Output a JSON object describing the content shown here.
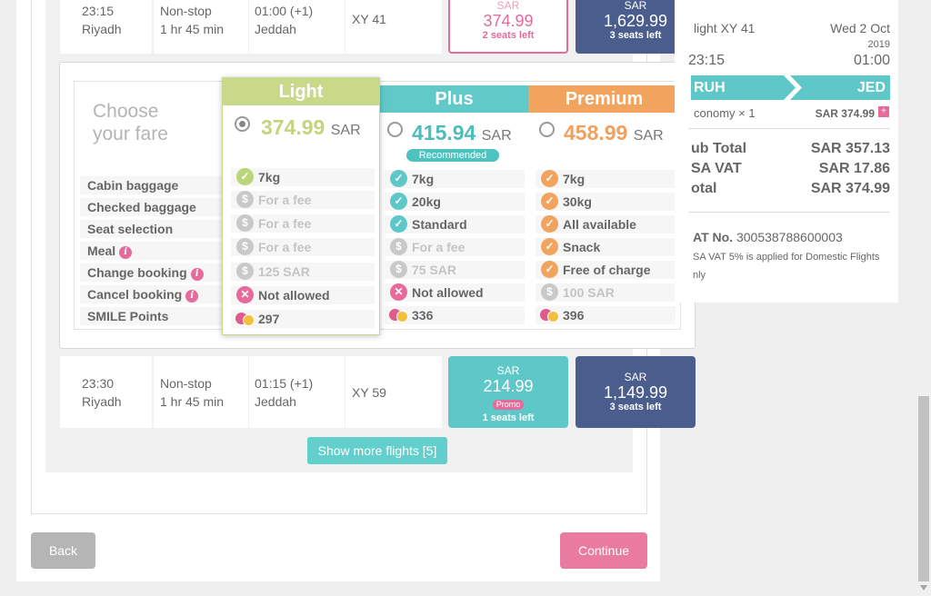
{
  "flights": [
    {
      "dep_time": "23:15",
      "dep_city": "Riyadh",
      "stops": "Non-stop",
      "duration": "1 hr 45 min",
      "arr_time": "01:00 (+1)",
      "arr_city": "Jeddah",
      "flight_no": "XY 41",
      "fare_a": {
        "currency": "SAR",
        "amount": "374.99",
        "seats": "2 seats left"
      },
      "fare_b": {
        "currency": "SAR",
        "amount": "1,629.99",
        "seats": "3 seats left"
      }
    },
    {
      "dep_time": "23:30",
      "dep_city": "Riyadh",
      "stops": "Non-stop",
      "duration": "1 hr 45 min",
      "arr_time": "01:15 (+1)",
      "arr_city": "Jeddah",
      "flight_no": "XY 59",
      "fare_a": {
        "currency": "SAR",
        "amount": "214.99",
        "promo": "Promo",
        "seats": "1 seats left"
      },
      "fare_b": {
        "currency": "SAR",
        "amount": "1,149.99",
        "seats": "3 seats left"
      }
    }
  ],
  "fare_panel": {
    "choose_line1": "Choose",
    "choose_line2": "your fare",
    "rows": [
      "Cabin baggage",
      "Checked baggage",
      "Seat selection",
      "Meal",
      "Change booking",
      "Cancel booking",
      "SMILE Points"
    ],
    "light": {
      "name": "Light",
      "price": "374.99",
      "currency": "SAR",
      "features": [
        "7kg",
        "For a fee",
        "For a fee",
        "For a fee",
        "125 SAR",
        "Not allowed",
        "297"
      ]
    },
    "plus": {
      "name": "Plus",
      "price": "415.94",
      "currency": "SAR",
      "badge": "Recommended",
      "features": [
        "7kg",
        "20kg",
        "Standard",
        "For a fee",
        "75 SAR",
        "Not allowed",
        "336"
      ]
    },
    "premium": {
      "name": "Premium",
      "price": "458.99",
      "currency": "SAR",
      "features": [
        "7kg",
        "30kg",
        "All available",
        "Snack",
        "Free of charge",
        "100 SAR",
        "396"
      ]
    }
  },
  "buttons": {
    "show_more": "Show more flights [5]",
    "back": "Back",
    "continue": "Continue"
  },
  "summary": {
    "flight_label": "light XY 41",
    "date": "Wed 2 Oct",
    "year": "2019",
    "dep_time": "23:15",
    "arr_time": "01:00",
    "origin": "RUH",
    "destination": "JED",
    "cabin": "conomy × 1",
    "cabin_price": "SAR 374.99",
    "subtotal_label": "ub Total",
    "subtotal": "SAR 357.13",
    "vat_label": "SA VAT",
    "vat": "SAR 17.86",
    "total_label": "otal",
    "total": "SAR 374.99",
    "vat_no_label": "AT No.",
    "vat_no": "300538788600003",
    "vat_note1": "SA VAT 5% is applied for Domestic Flights",
    "vat_note2": "nly"
  },
  "colors": {
    "light": "#c9d98a",
    "plus": "#62c9c9",
    "premium": "#f2a35e",
    "pink": "#e46b9b",
    "navy": "#4a5d8c",
    "teal": "#5ec8c8"
  }
}
